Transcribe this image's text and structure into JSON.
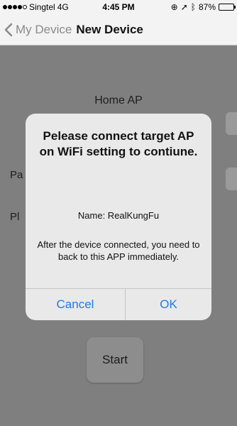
{
  "statusbar": {
    "carrier": "Singtel",
    "network": "4G",
    "time": "4:45 PM",
    "battery": "87%",
    "battery_level": 0.87,
    "signal_bars": 4,
    "signal_max": 5
  },
  "nav": {
    "back_label": "My Device",
    "title": "New Device"
  },
  "form": {
    "home_ap_label": "Home AP",
    "password_label_fragment": "Pa",
    "pl_label_fragment": "Pl",
    "start_label": "Start"
  },
  "alert": {
    "title": "Pelease connect target AP on WiFi setting to contiune.",
    "name": "Name: RealKungFu",
    "message": "After the device connected, you need to back to this APP immediately.",
    "cancel_label": "Cancel",
    "ok_label": "OK"
  },
  "colors": {
    "link_blue": "#1f7ae0",
    "overlay_gray": "#7f7f7f"
  }
}
